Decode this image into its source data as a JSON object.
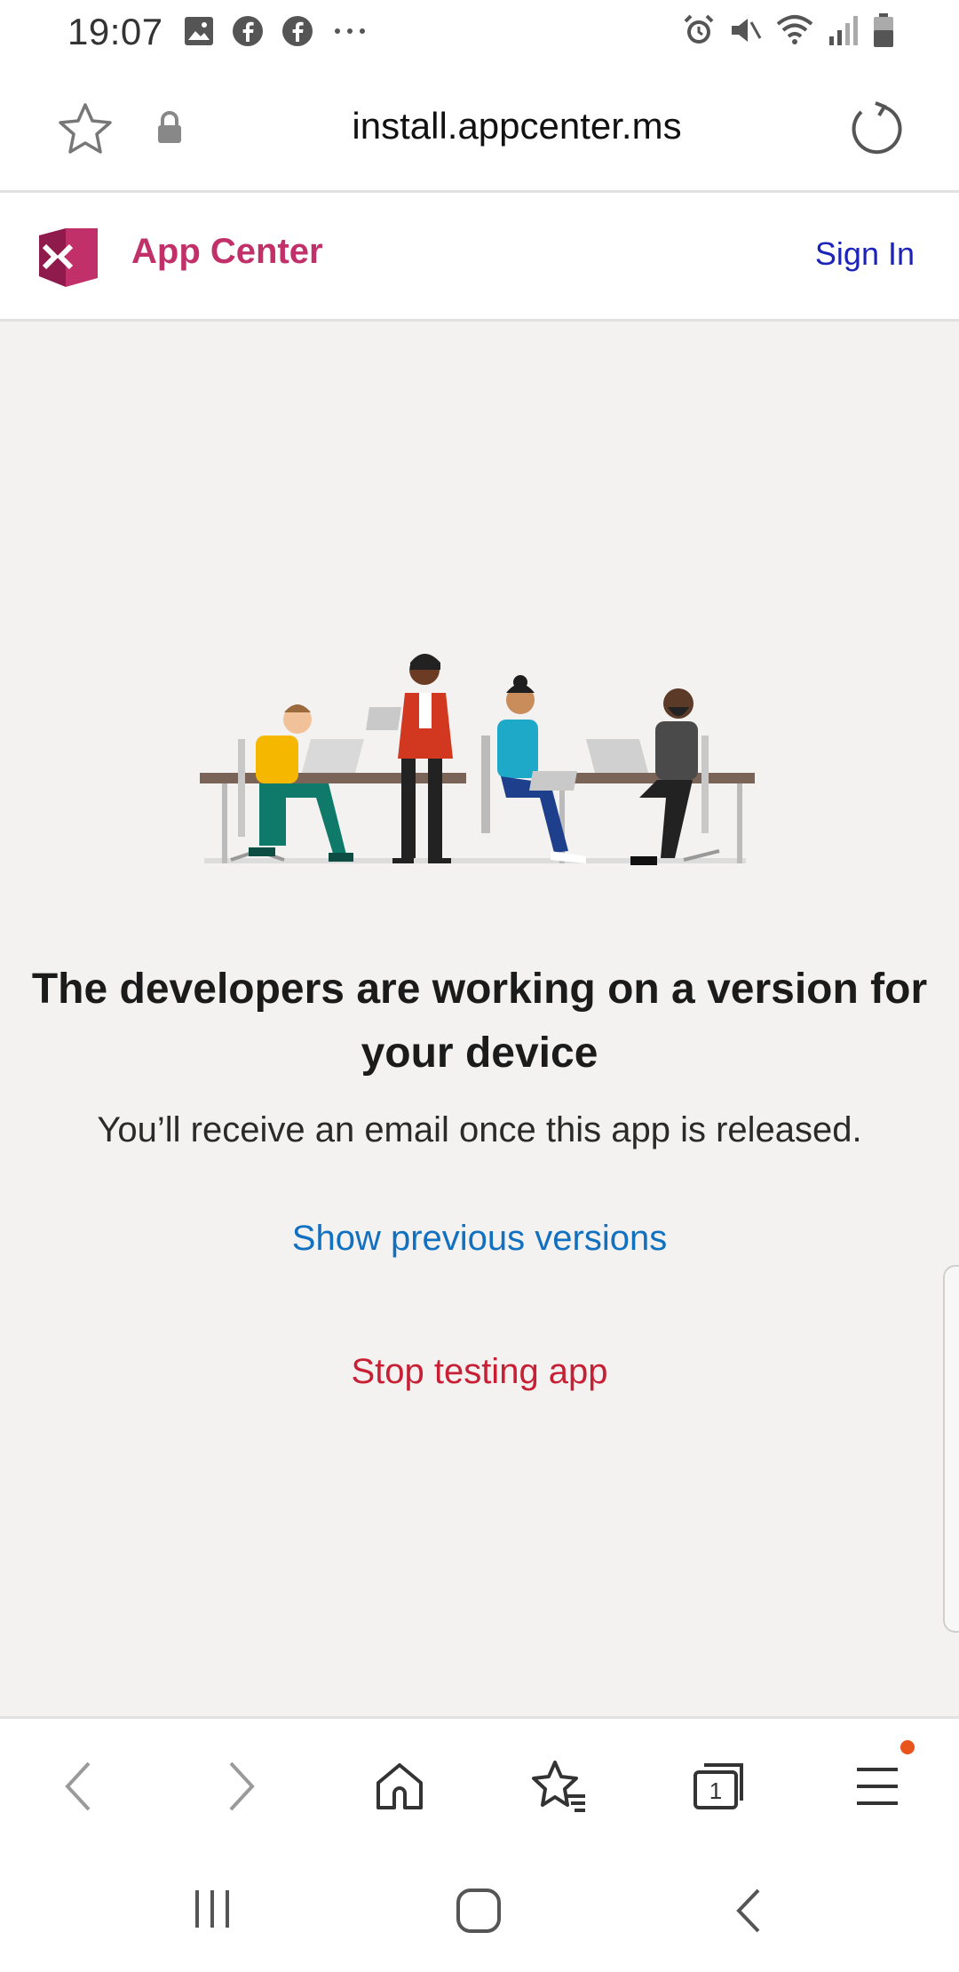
{
  "status_bar": {
    "time": "19:07",
    "left_icons": [
      "gallery-icon",
      "facebook-icon",
      "facebook-icon",
      "more-dots-icon"
    ],
    "right_icons": [
      "alarm-icon",
      "mute-icon",
      "wifi-icon",
      "signal-icon",
      "battery-icon"
    ]
  },
  "url_bar": {
    "url": "install.appcenter.ms",
    "icons": [
      "star-icon",
      "lock-icon",
      "reload-icon"
    ]
  },
  "app_header": {
    "title": "App Center",
    "sign_in": "Sign In",
    "brand_color": "#c23069",
    "link_color": "#1b23b9"
  },
  "main": {
    "headline": "The developers are working on a version for your device",
    "subtext": "You’ll receive an email once this app is released.",
    "show_previous": "Show previous versions",
    "stop_testing": "Stop testing app",
    "link_color": "#1170c0",
    "danger_color": "#c71f34"
  },
  "bottom_bar": {
    "tab_count": "1",
    "icons": [
      "back-icon",
      "forward-icon",
      "home-icon",
      "bookmarks-icon",
      "tabs-icon",
      "menu-icon"
    ],
    "notification_color": "#e9541c"
  },
  "system_nav": {
    "icons": [
      "recents-icon",
      "home-square-icon",
      "system-back-icon"
    ]
  }
}
